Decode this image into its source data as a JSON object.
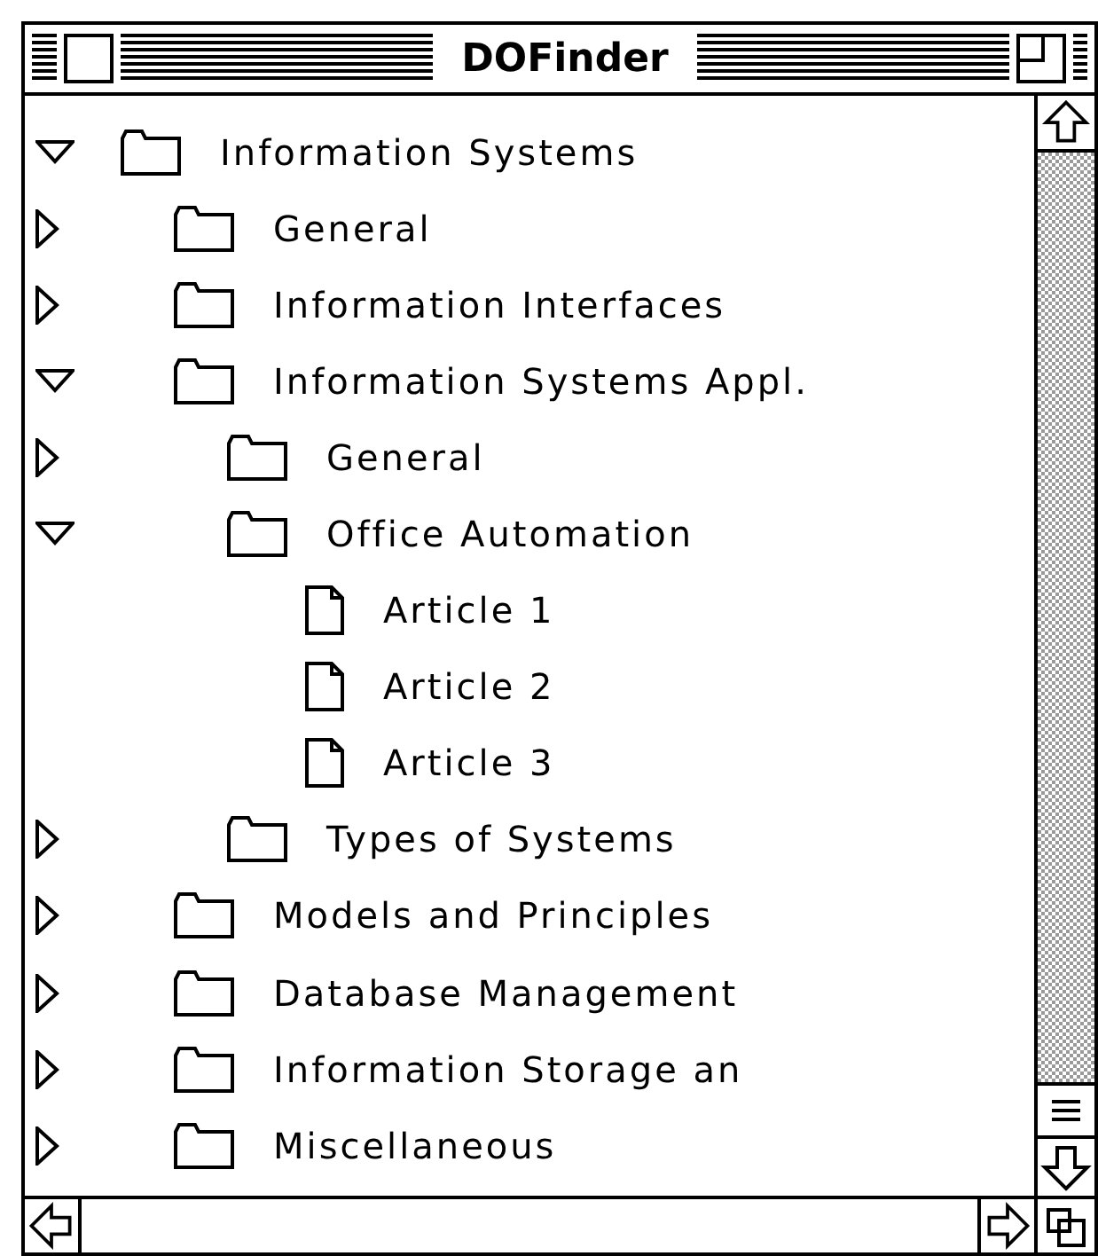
{
  "window": {
    "title": "DOFinder"
  },
  "tree": [
    {
      "label": "Information Systems",
      "kind": "folder",
      "expanded": true,
      "children": [
        {
          "label": "General",
          "kind": "folder",
          "expanded": false
        },
        {
          "label": "Information Interfaces",
          "kind": "folder",
          "expanded": false
        },
        {
          "label": "Information Systems Appl.",
          "kind": "folder",
          "expanded": true,
          "children": [
            {
              "label": "General",
              "kind": "folder",
              "expanded": false
            },
            {
              "label": "Office Automation",
              "kind": "folder",
              "expanded": true,
              "children": [
                {
                  "label": "Article 1",
                  "kind": "document"
                },
                {
                  "label": "Article 2",
                  "kind": "document"
                },
                {
                  "label": "Article 3",
                  "kind": "document"
                }
              ]
            },
            {
              "label": "Types of Systems",
              "kind": "folder",
              "expanded": false
            }
          ]
        },
        {
          "label": "Models and Principles",
          "kind": "folder",
          "expanded": false
        },
        {
          "label": "Database Management",
          "kind": "folder",
          "expanded": false
        },
        {
          "label": "Information Storage an",
          "kind": "folder",
          "expanded": false
        },
        {
          "label": "Miscellaneous",
          "kind": "folder",
          "expanded": false
        }
      ]
    }
  ]
}
